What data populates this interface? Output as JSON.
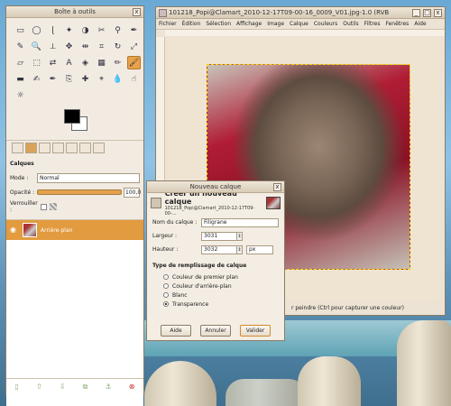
{
  "toolbox": {
    "title": "Boîte à outils",
    "close": "x",
    "tool_icons": [
      "rect-select-icon",
      "ellipse-select-icon",
      "lasso-icon",
      "wand-icon",
      "color-select-icon",
      "scissors-icon",
      "foreground-select-icon",
      "paths-icon",
      "color-picker-icon",
      "zoom-icon",
      "measure-icon",
      "move-icon",
      "align-icon",
      "crop-icon",
      "rotate-icon",
      "scale-icon",
      "shear-icon",
      "perspective-icon",
      "flip-icon",
      "text-icon",
      "bucket-icon",
      "blend-icon",
      "pencil-icon",
      "brush-icon",
      "eraser-icon",
      "airbrush-icon",
      "ink-icon",
      "clone-icon",
      "heal-icon",
      "perspective-clone-icon",
      "blur-icon",
      "smudge-icon",
      "dodge-icon"
    ],
    "tool_glyphs": [
      "▭",
      "◯",
      "ɭ",
      "✦",
      "◑",
      "✂",
      "⚲",
      "✒",
      "✎",
      "🔍",
      "⟂",
      "✥",
      "⇹",
      "⌗",
      "↻",
      "⤢",
      "▱",
      "⬚",
      "⇄",
      "A",
      "◈",
      "▦",
      "✏",
      "🖌",
      "▬",
      "✍",
      "✒",
      "⎘",
      "✚",
      "⌖",
      "💧",
      "☝",
      "☼"
    ],
    "selected_tool_index": 23,
    "calques_label": "Calques",
    "mode_label": "Mode :",
    "mode_value": "Normal",
    "opacity_label": "Opacité :",
    "opacity_value": "100,0",
    "lock_label": "Verrouiller :",
    "layer_name": "Arrière-plan"
  },
  "image_window": {
    "title": "101218_Popi@Clamart_2010-12-17T09-00-16_0009_V01.jpg-1.0 (RVB",
    "menu": [
      "Fichier",
      "Édition",
      "Sélection",
      "Affichage",
      "Image",
      "Calque",
      "Couleurs",
      "Outils",
      "Filtres",
      "Fenêtres",
      "Aide"
    ],
    "status_text": "r peindre (Ctrl pour capturer une couleur)"
  },
  "dialog": {
    "window_title": "Nouveau calque",
    "heading": "Créer un nouveau calque",
    "subheading": "101218_Popi@Clamart_2010-12-17T09-00-...",
    "name_label": "Nom du calque :",
    "name_value": "Filigrane",
    "width_label": "Largeur :",
    "width_value": "3031",
    "height_label": "Hauteur :",
    "height_value": "3032",
    "unit_value": "px",
    "fill_title": "Type de remplissage de calque",
    "fill_options": [
      "Couleur de premier plan",
      "Couleur d'arrière-plan",
      "Blanc",
      "Transparence"
    ],
    "fill_selected": 3,
    "help_button": "Aide",
    "cancel_button": "Annuler",
    "ok_button": "Valider"
  }
}
